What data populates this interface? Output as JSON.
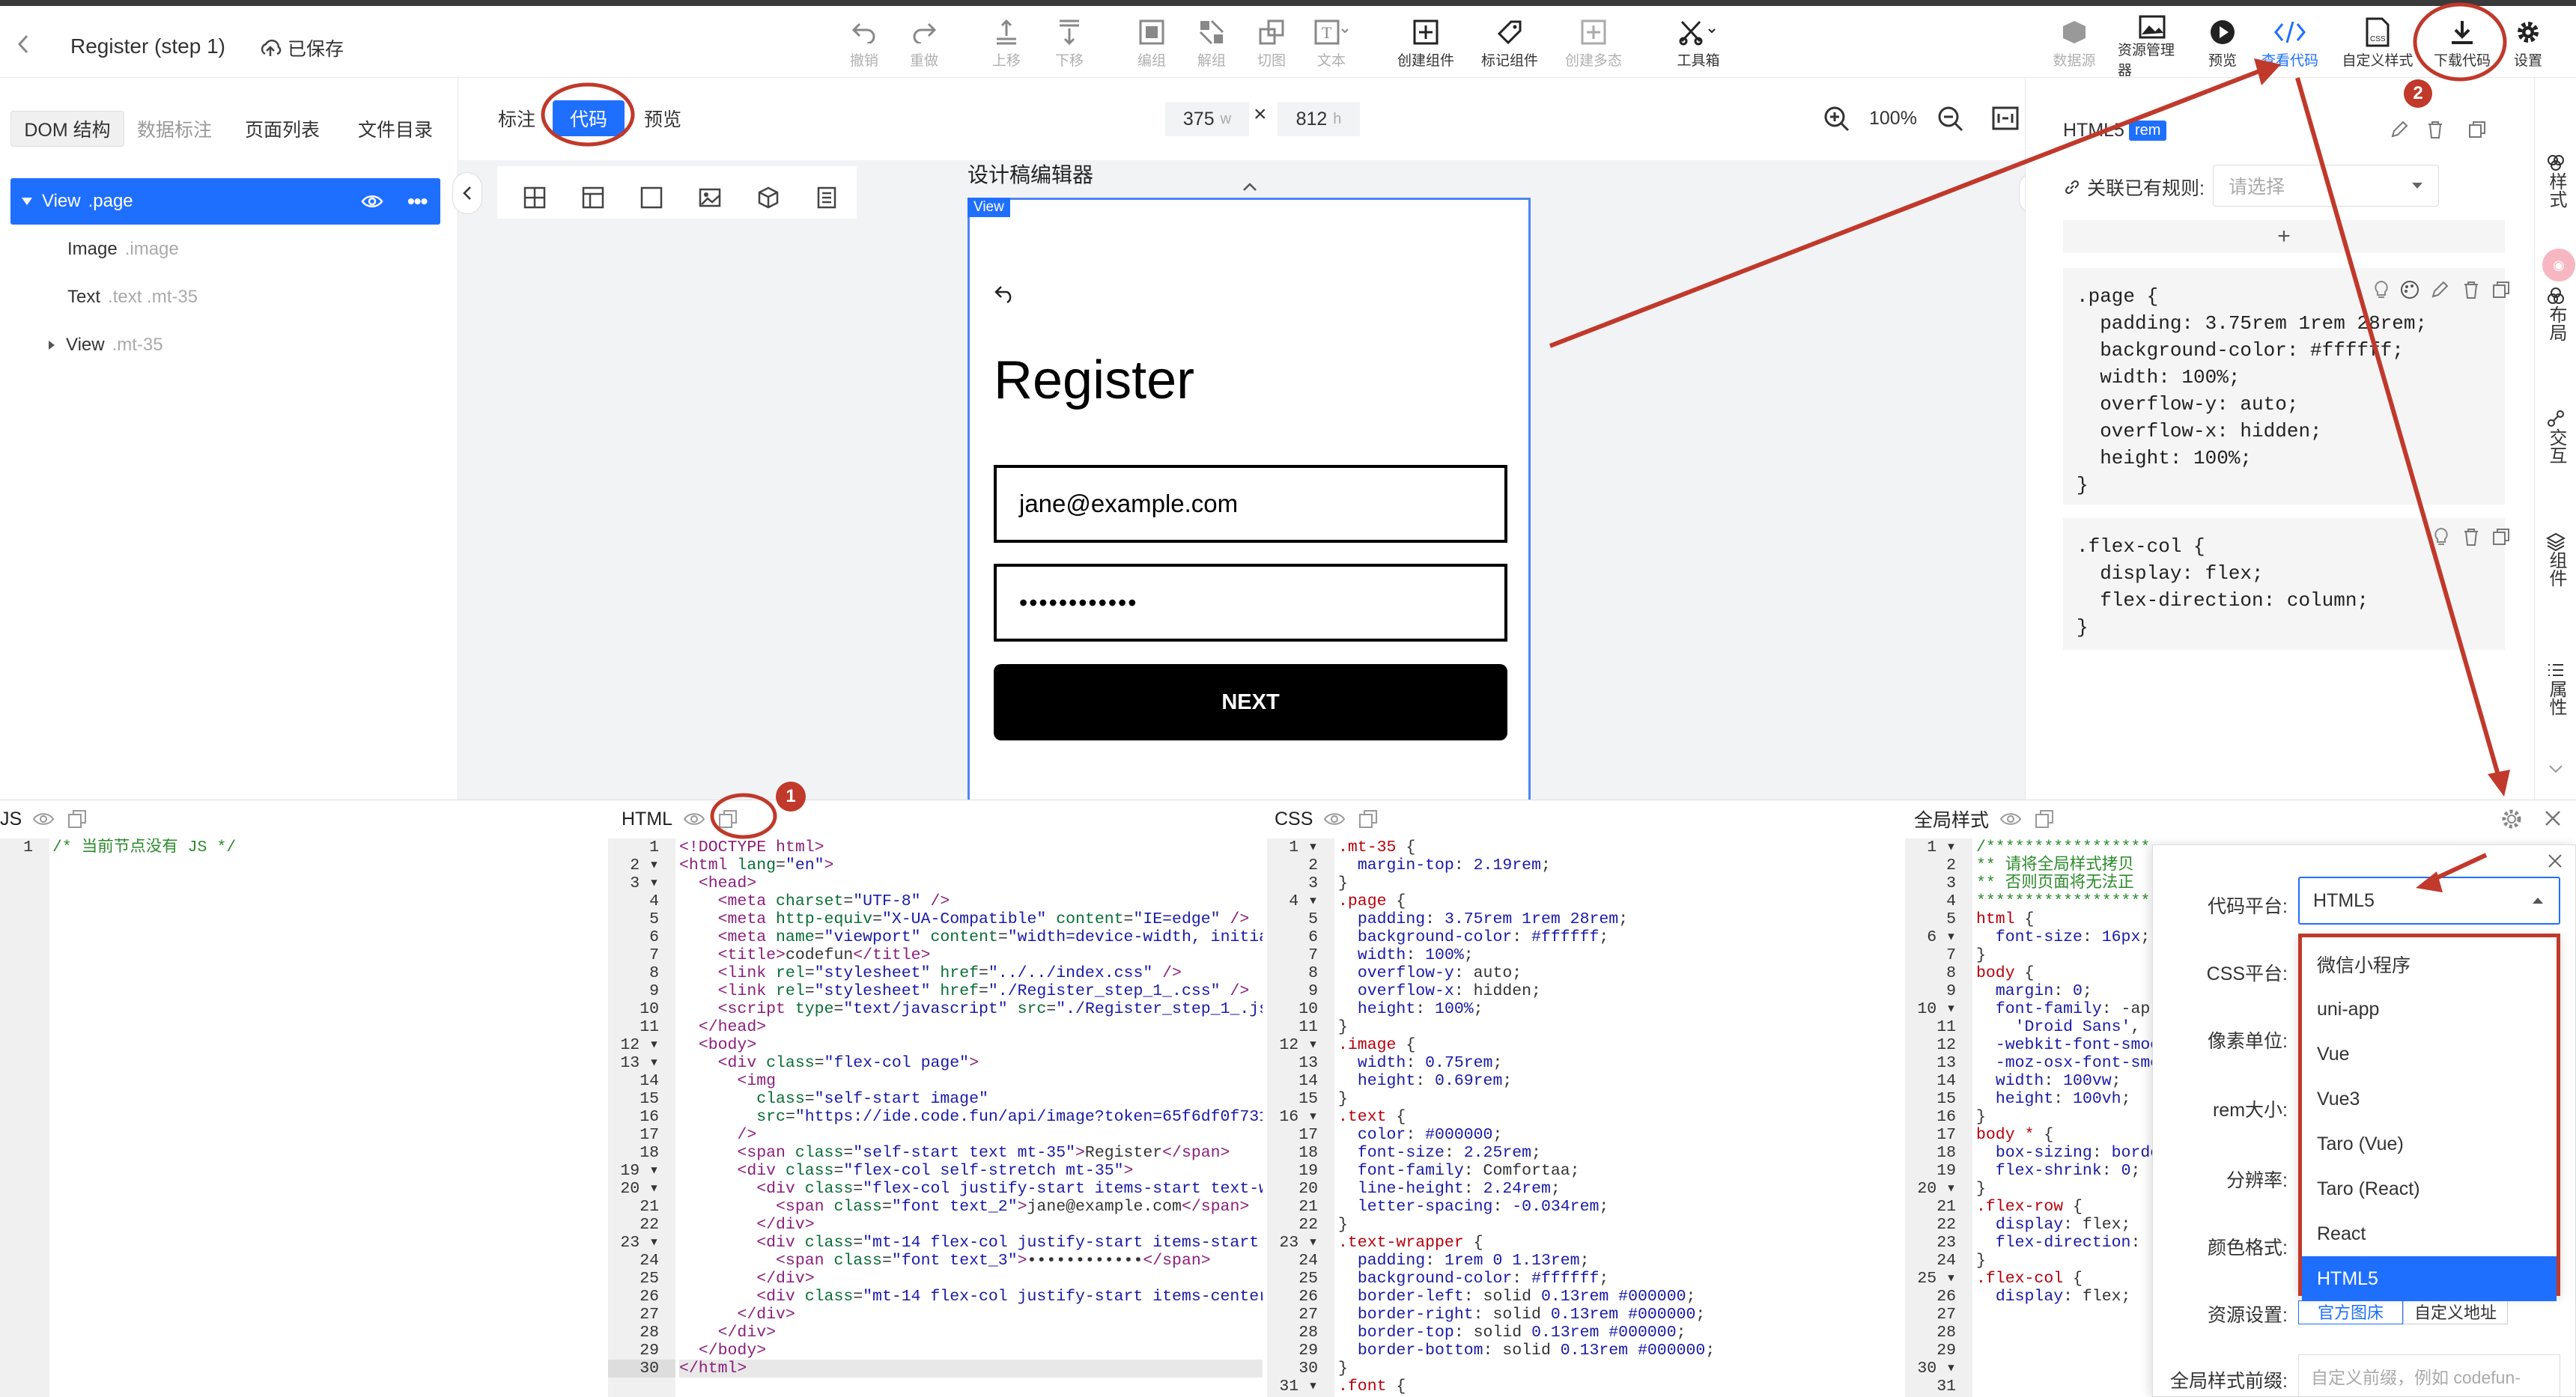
{
  "header": {
    "back_icon": "chevron-left-icon",
    "title": "Register (step 1)",
    "saved_label": "已保存",
    "tools": [
      {
        "label": "撤销",
        "icon": "undo-icon"
      },
      {
        "label": "重做",
        "icon": "redo-icon"
      },
      {
        "label": "上移",
        "icon": "move-up-icon"
      },
      {
        "label": "下移",
        "icon": "move-down-icon"
      },
      {
        "label": "编组",
        "icon": "group-icon"
      },
      {
        "label": "解组",
        "icon": "ungroup-icon"
      },
      {
        "label": "切图",
        "icon": "slice-icon"
      },
      {
        "label": "文本",
        "icon": "text-icon"
      },
      {
        "label": "创建组件",
        "icon": "create-component-icon"
      },
      {
        "label": "标记组件",
        "icon": "tag-component-icon"
      },
      {
        "label": "创建多态",
        "icon": "create-variant-icon"
      },
      {
        "label": "工具箱",
        "icon": "toolbox-icon"
      }
    ],
    "right_tools": [
      {
        "label": "数据源",
        "icon": "database-icon"
      },
      {
        "label": "资源管理器",
        "icon": "image-icon"
      },
      {
        "label": "预览",
        "icon": "play-icon"
      },
      {
        "label": "查看代码",
        "icon": "code-icon"
      },
      {
        "label": "自定义样式",
        "icon": "css-file-icon"
      },
      {
        "label": "下载代码",
        "icon": "download-icon"
      },
      {
        "label": "设置",
        "icon": "gear-icon"
      }
    ],
    "badge_2": "2"
  },
  "left_panel": {
    "tabs": [
      "DOM 结构",
      "数据标注",
      "页面列表",
      "文件目录"
    ],
    "tree": [
      {
        "label": "View",
        "sub": ".page"
      },
      {
        "label": "Image",
        "sub": ".image"
      },
      {
        "label": "Text",
        "sub": ".text .mt-35"
      },
      {
        "label": "View",
        "sub": ".mt-35"
      }
    ]
  },
  "canvas": {
    "modes": [
      "标注",
      "代码",
      "预览"
    ],
    "width_value": "375",
    "width_unit": "w",
    "height_value": "812",
    "height_unit": "h",
    "zoom": "100%",
    "editor_title": "设计稿编辑器",
    "view_tag": "View",
    "phone": {
      "heading": "Register",
      "email": "jane@example.com",
      "password": "••••••••••••",
      "button": "NEXT"
    }
  },
  "right_panel": {
    "html5_label": "HTML5",
    "rem_label": "rem",
    "rule_label": "关联已有规则:",
    "rule_placeholder": "请选择",
    "add_label": "+",
    "css_block_1": ".page {\n  padding: 3.75rem 1rem 28rem;\n  background-color: #ffffff;\n  width: 100%;\n  overflow-y: auto;\n  overflow-x: hidden;\n  height: 100%;\n}",
    "css_block_2": ".flex-col {\n  display: flex;\n  flex-direction: column;\n}",
    "side_tabs": [
      "样式",
      "布局",
      "交互",
      "组件",
      "属性"
    ]
  },
  "bottom": {
    "js_title": "JS",
    "html_title": "HTML",
    "css_title": "CSS",
    "global_title": "全局样式",
    "badge_1": "1",
    "js_comment": "/* 当前节点没有 JS */"
  },
  "popup": {
    "labels": [
      "代码平台:",
      "CSS平台:",
      "像素单位:",
      "rem大小:",
      "分辨率:",
      "颜色格式:",
      "资源设置:",
      "全局样式前缀:"
    ],
    "platform_selected": "HTML5",
    "options": [
      "微信小程序",
      "uni-app",
      "Vue",
      "Vue3",
      "Taro (Vue)",
      "Taro (React)",
      "React",
      "HTML5"
    ],
    "resource_btn_1": "官方图床",
    "resource_btn_2": "自定义地址",
    "prefix_placeholder": "自定义前缀，例如 codefun-"
  },
  "colors": {
    "accent": "#1f6fff",
    "annotation_red": "#c0392b"
  }
}
